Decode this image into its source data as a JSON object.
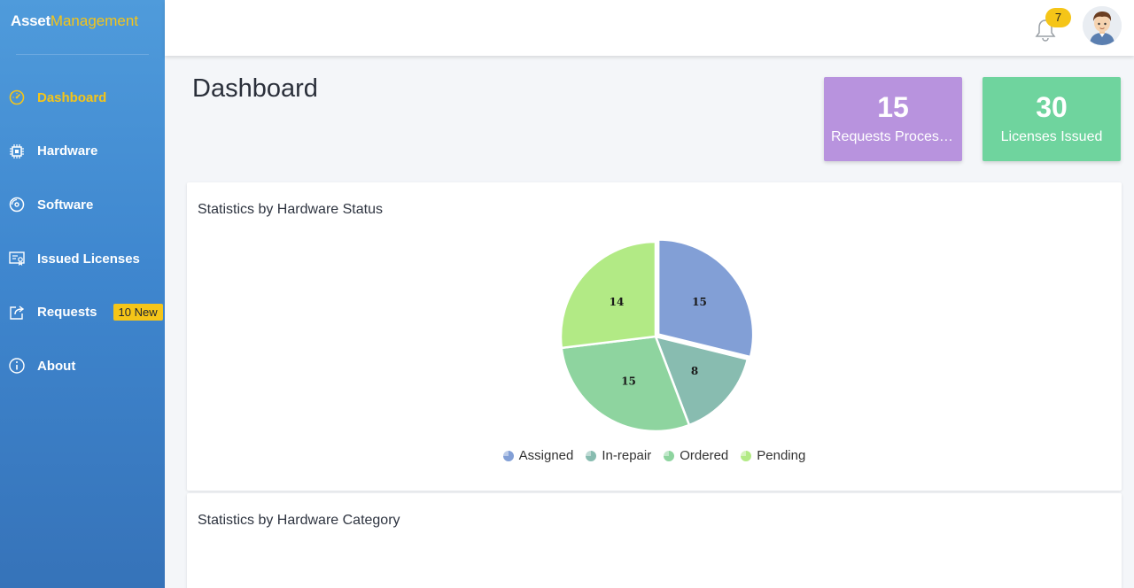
{
  "brand": {
    "part1": "Asset",
    "part2": "Management"
  },
  "sidebar": {
    "items": [
      {
        "label": "Dashboard",
        "icon": "speedometer-icon"
      },
      {
        "label": "Hardware",
        "icon": "chip-icon"
      },
      {
        "label": "Software",
        "icon": "disc-icon"
      },
      {
        "label": "Issued Licenses",
        "icon": "certificate-icon"
      },
      {
        "label": "Requests",
        "icon": "share-icon",
        "badge": "10 New"
      },
      {
        "label": "About",
        "icon": "info-icon"
      }
    ]
  },
  "topbar": {
    "notification_count": "7"
  },
  "page": {
    "title": "Dashboard"
  },
  "stats": {
    "requests": {
      "value": "15",
      "label": "Requests Processed"
    },
    "licenses": {
      "value": "30",
      "label": "Licenses Issued"
    }
  },
  "panels": {
    "status_title": "Statistics by Hardware Status",
    "category_title": "Statistics by Hardware Category"
  },
  "colors": {
    "accent": "#f5c518",
    "assigned": "#829fd6",
    "in_repair": "#88bcb0",
    "ordered": "#8ed49f",
    "pending": "#b2ea85"
  },
  "chart_data": {
    "type": "pie",
    "title": "Statistics by Hardware Status",
    "categories": [
      "Assigned",
      "In-repair",
      "Ordered",
      "Pending"
    ],
    "values": [
      15,
      8,
      15,
      14
    ],
    "legend_position": "bottom"
  }
}
